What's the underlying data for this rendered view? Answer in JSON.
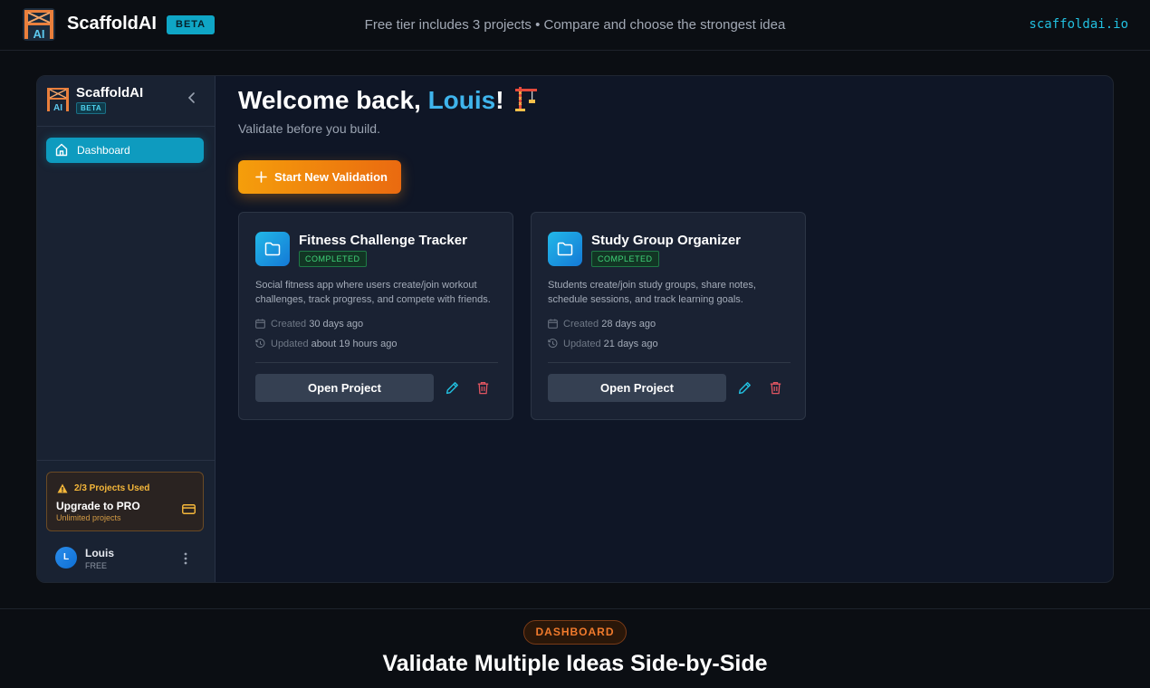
{
  "topbar": {
    "brand_name": "ScaffoldAI",
    "beta_label": "BETA",
    "tagline": "Free tier includes 3 projects • Compare and choose the strongest idea",
    "domain": "scaffoldai.io"
  },
  "sidebar": {
    "brand_name": "ScaffoldAI",
    "beta_label": "BETA",
    "nav": [
      {
        "label": "Dashboard",
        "icon": "home-icon",
        "active": true
      }
    ],
    "upgrade": {
      "usage": "2/3 Projects Used",
      "title": "Upgrade to PRO",
      "subtitle": "Unlimited projects",
      "icon": "credit-card-icon"
    },
    "user": {
      "initial": "L",
      "name": "Louis",
      "plan": "FREE"
    }
  },
  "main": {
    "welcome_prefix": "Welcome back, ",
    "user_name": "Louis",
    "welcome_suffix": "!",
    "subtitle": "Validate before you build.",
    "start_button": "Start New Validation",
    "projects": [
      {
        "title": "Fitness Challenge Tracker",
        "status": "COMPLETED",
        "description": "Social fitness app where users create/join workout challenges, track progress, and compete with friends.",
        "created_label": "Created",
        "created": "30 days ago",
        "updated_label": "Updated",
        "updated": "about 19 hours ago",
        "open_label": "Open Project"
      },
      {
        "title": "Study Group Organizer",
        "status": "COMPLETED",
        "description": "Students create/join study groups, share notes, schedule sessions, and track learning goals.",
        "created_label": "Created",
        "created": "28 days ago",
        "updated_label": "Updated",
        "updated": "21 days ago",
        "open_label": "Open Project"
      }
    ]
  },
  "section": {
    "pill": "DASHBOARD",
    "title": "Validate Multiple Ideas Side-by-Side"
  },
  "colors": {
    "accent": "#0e9bbf",
    "cta": "#f59e0b",
    "success": "#40d47a",
    "warning": "#f5b73a",
    "danger": "#e05561"
  }
}
